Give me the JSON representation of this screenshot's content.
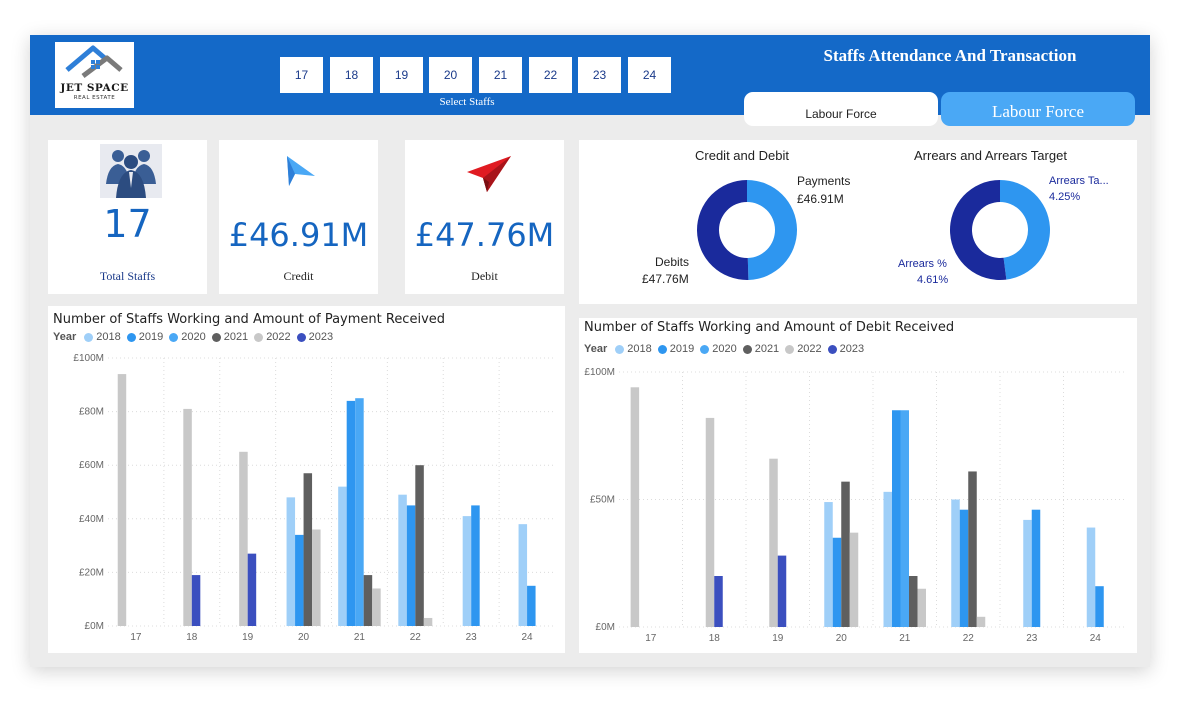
{
  "header": {
    "title": "Staffs Attendance And Transaction",
    "logo_line1": "JET SPACE",
    "logo_line2": "REAL ESTATE",
    "slicer_label": "Select Staffs",
    "slicer_options": [
      "17",
      "18",
      "19",
      "20",
      "21",
      "22",
      "23",
      "24"
    ],
    "button_labour_force_1": "Labour Force",
    "button_labour_force_2": "Labour Force"
  },
  "kpis": {
    "total_staffs": {
      "value": "17",
      "label": "Total Staffs",
      "icon": "people-group-icon"
    },
    "credit": {
      "value": "£46.91M",
      "label": "Credit",
      "icon": "paper-plane-blue-icon"
    },
    "debit": {
      "value": "£47.76M",
      "label": "Debit",
      "icon": "paper-plane-red-icon"
    }
  },
  "donuts": {
    "credit_debit": {
      "title": "Credit and Debit",
      "slices": [
        {
          "label": "Payments",
          "value_label": "£46.91M",
          "value": 46.91,
          "color": "#2e96f0"
        },
        {
          "label": "Debits",
          "value_label": "£47.76M",
          "value": 47.76,
          "color": "#1a2a9c"
        }
      ]
    },
    "arrears": {
      "title": "Arrears and Arrears Target",
      "slices": [
        {
          "label": "Arrears Ta...",
          "value_label": "4.25%",
          "value": 4.25,
          "color": "#2e96f0"
        },
        {
          "label": "Arrears %",
          "value_label": "4.61%",
          "value": 4.61,
          "color": "#1a2a9c"
        }
      ]
    }
  },
  "legend": {
    "title": "Year",
    "years": [
      {
        "name": "2018",
        "color": "#9fcff8"
      },
      {
        "name": "2019",
        "color": "#2e96f0"
      },
      {
        "name": "2020",
        "color": "#4aa8f5"
      },
      {
        "name": "2021",
        "color": "#5f5f5f"
      },
      {
        "name": "2022",
        "color": "#c8c8c8"
      },
      {
        "name": "2023",
        "color": "#3b4fbf"
      }
    ]
  },
  "chart_data": [
    {
      "type": "bar",
      "title": "Number of Staffs Working and Amount of Payment Received",
      "categories": [
        "17",
        "18",
        "19",
        "20",
        "21",
        "22",
        "23",
        "24"
      ],
      "ylim": [
        0,
        100
      ],
      "yticks": [
        "£0M",
        "£20M",
        "£40M",
        "£60M",
        "£80M",
        "£100M"
      ],
      "grid": true,
      "legend_position": "top-left",
      "groups": [
        [
          {
            "year": "2022",
            "value": 94
          }
        ],
        [
          {
            "year": "2022",
            "value": 81
          },
          {
            "year": "2023",
            "value": 19
          }
        ],
        [
          {
            "year": "2022",
            "value": 65
          },
          {
            "year": "2023",
            "value": 27
          }
        ],
        [
          {
            "year": "2018",
            "value": 48
          },
          {
            "year": "2019",
            "value": 34
          },
          {
            "year": "2021",
            "value": 57
          },
          {
            "year": "2022",
            "value": 36
          }
        ],
        [
          {
            "year": "2018",
            "value": 52
          },
          {
            "year": "2019",
            "value": 84
          },
          {
            "year": "2020",
            "value": 85
          },
          {
            "year": "2021",
            "value": 19
          },
          {
            "year": "2022",
            "value": 14
          }
        ],
        [
          {
            "year": "2018",
            "value": 49
          },
          {
            "year": "2019",
            "value": 45
          },
          {
            "year": "2021",
            "value": 60
          },
          {
            "year": "2022",
            "value": 3
          }
        ],
        [
          {
            "year": "2018",
            "value": 41
          },
          {
            "year": "2019",
            "value": 45
          }
        ],
        [
          {
            "year": "2018",
            "value": 38
          },
          {
            "year": "2019",
            "value": 15
          }
        ]
      ]
    },
    {
      "type": "bar",
      "title": "Number of Staffs Working and Amount of Debit Received",
      "categories": [
        "17",
        "18",
        "19",
        "20",
        "21",
        "22",
        "23",
        "24"
      ],
      "ylim": [
        0,
        100
      ],
      "yticks": [
        "£0M",
        "£50M",
        "£100M"
      ],
      "grid": true,
      "legend_position": "top-left",
      "groups": [
        [
          {
            "year": "2022",
            "value": 94
          }
        ],
        [
          {
            "year": "2022",
            "value": 82
          },
          {
            "year": "2023",
            "value": 20
          }
        ],
        [
          {
            "year": "2022",
            "value": 66
          },
          {
            "year": "2023",
            "value": 28
          }
        ],
        [
          {
            "year": "2018",
            "value": 49
          },
          {
            "year": "2019",
            "value": 35
          },
          {
            "year": "2021",
            "value": 57
          },
          {
            "year": "2022",
            "value": 37
          }
        ],
        [
          {
            "year": "2018",
            "value": 53
          },
          {
            "year": "2019",
            "value": 85
          },
          {
            "year": "2020",
            "value": 85
          },
          {
            "year": "2021",
            "value": 20
          },
          {
            "year": "2022",
            "value": 15
          }
        ],
        [
          {
            "year": "2018",
            "value": 50
          },
          {
            "year": "2019",
            "value": 46
          },
          {
            "year": "2021",
            "value": 61
          },
          {
            "year": "2022",
            "value": 4
          }
        ],
        [
          {
            "year": "2018",
            "value": 42
          },
          {
            "year": "2019",
            "value": 46
          }
        ],
        [
          {
            "year": "2018",
            "value": 39
          },
          {
            "year": "2019",
            "value": 16
          }
        ]
      ]
    }
  ]
}
